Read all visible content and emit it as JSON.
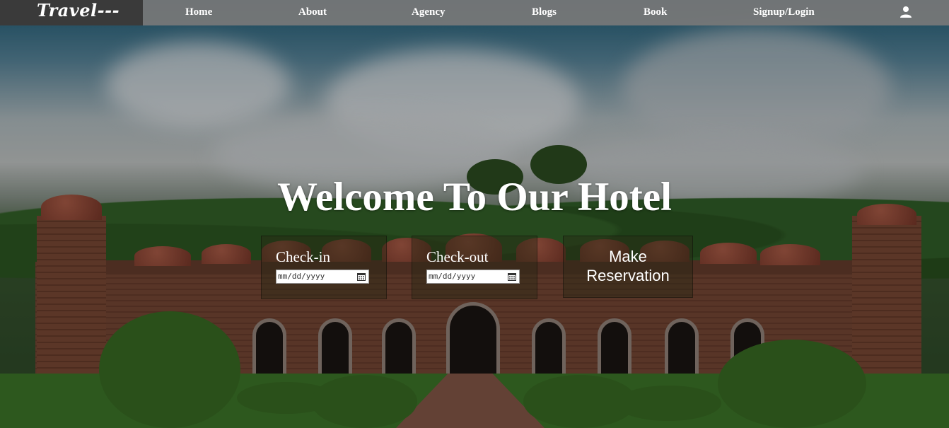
{
  "nav": {
    "logo": "Travel---",
    "items": [
      {
        "label": "Home"
      },
      {
        "label": "About"
      },
      {
        "label": "Agency"
      },
      {
        "label": "Blogs"
      },
      {
        "label": "Book"
      },
      {
        "label": "Signup/Login"
      }
    ],
    "user_icon": "user-icon"
  },
  "hero": {
    "title": "Welcome To Our Hotel",
    "checkin": {
      "label": "Check-in",
      "placeholder": "mm/dd/yyyy"
    },
    "checkout": {
      "label": "Check-out",
      "placeholder": "mm/dd/yyyy"
    },
    "reserve": {
      "line1": "Make",
      "line2": "Reservation"
    }
  },
  "colors": {
    "nav_bg": "#787878",
    "logo_bg": "#3a3a3a",
    "text": "#ffffff"
  }
}
